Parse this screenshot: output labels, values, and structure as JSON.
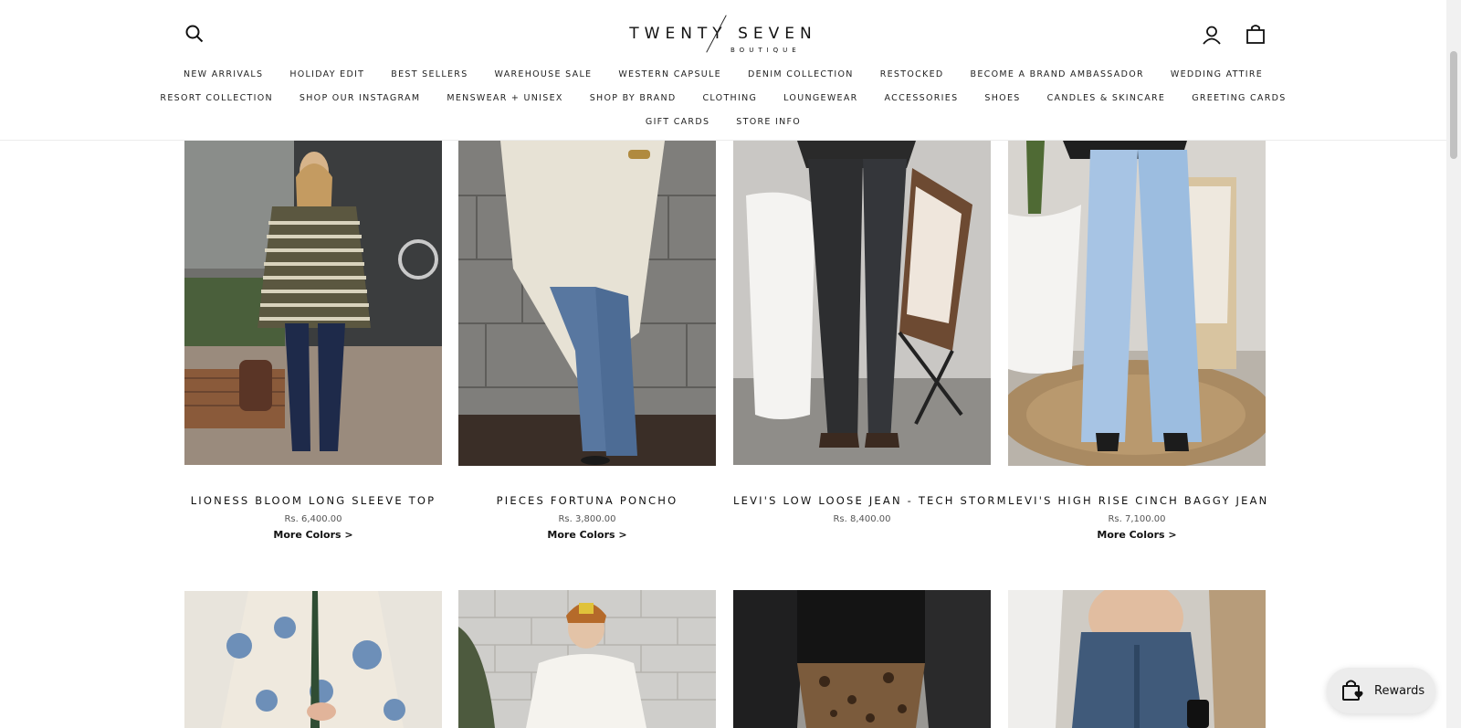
{
  "brand": {
    "name": "TWENTY SEVEN",
    "sub": "BOUTIQUE"
  },
  "header": {
    "search_icon": "search-icon",
    "account_icon": "user-icon",
    "cart_icon": "shopping-bag-icon"
  },
  "nav": {
    "row1": [
      "NEW ARRIVALS",
      "HOLIDAY EDIT",
      "BEST SELLERS",
      "WAREHOUSE SALE",
      "WESTERN CAPSULE",
      "DENIM COLLECTION",
      "RESTOCKED",
      "BECOME A BRAND AMBASSADOR",
      "WEDDING ATTIRE"
    ],
    "row2": [
      "RESORT COLLECTION",
      "SHOP OUR INSTAGRAM",
      "MENSWEAR + UNISEX",
      "SHOP BY BRAND",
      "CLOTHING",
      "LOUNGEWEAR",
      "ACCESSORIES",
      "SHOES",
      "CANDLES & SKINCARE",
      "GREETING CARDS"
    ],
    "row3": [
      "GIFT CARDS",
      "STORE INFO"
    ]
  },
  "products": [
    {
      "title": "LIONESS BLOOM LONG SLEEVE TOP",
      "price": "Rs. 6,400.00",
      "more": "More Colors >"
    },
    {
      "title": "PIECES FORTUNA PONCHO",
      "price": "Rs. 3,800.00",
      "more": "More Colors >"
    },
    {
      "title": "LEVI'S LOW LOOSE JEAN - TECH STORM",
      "price": "Rs. 8,400.00",
      "more": ""
    },
    {
      "title": "LEVI'S HIGH RISE CINCH BAGGY JEAN",
      "price": "Rs. 7,100.00",
      "more": "More Colors >"
    }
  ],
  "rewards": {
    "label": "Rewards",
    "icon": "shopping-bag-heart-icon"
  },
  "colors": {
    "accent": "#111111",
    "background": "#ffffff",
    "rewards_bg": "#ececec"
  }
}
